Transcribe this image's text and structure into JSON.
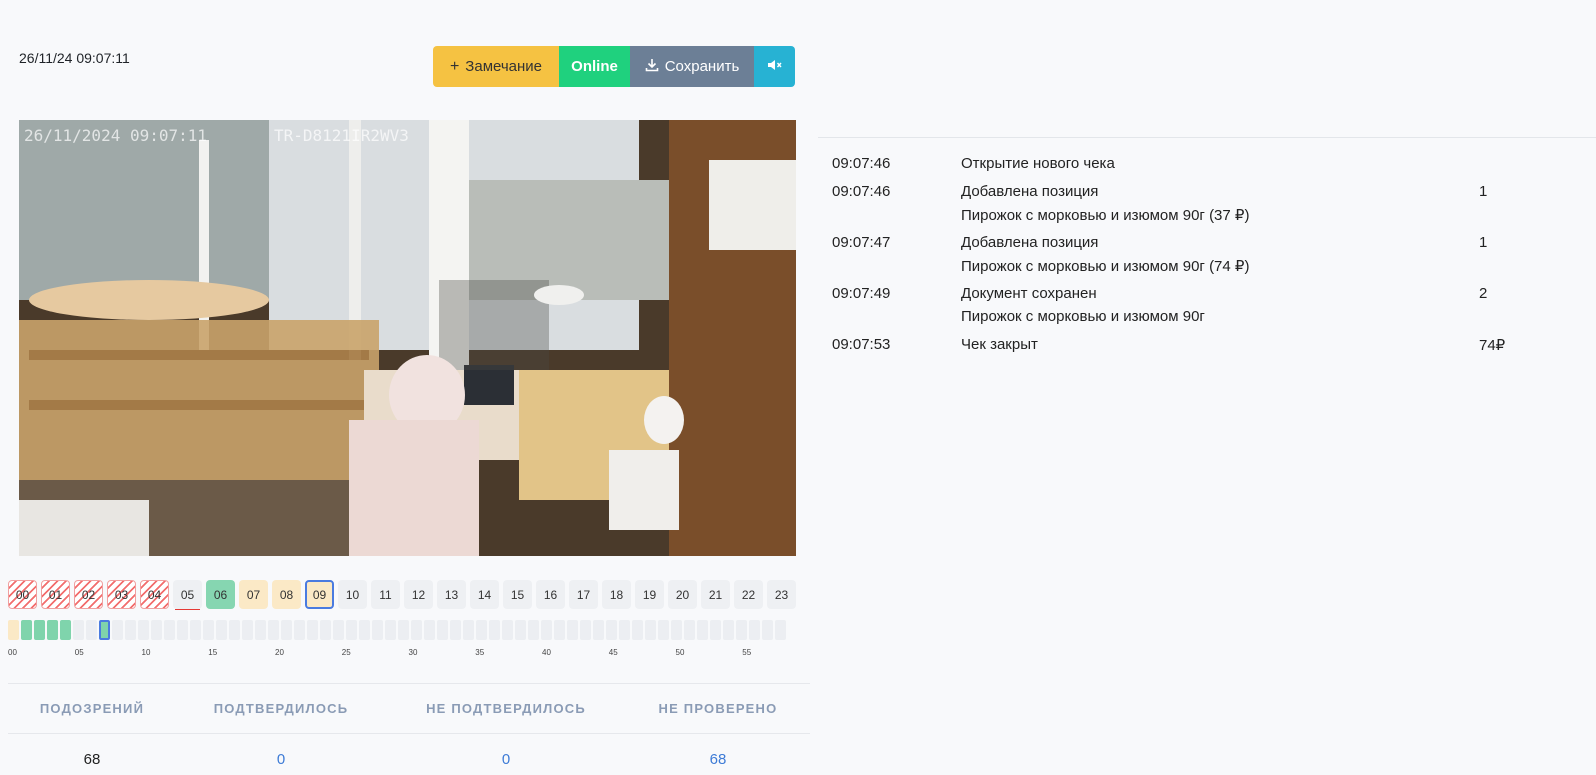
{
  "header": {
    "timestamp": "26/11/24 09:07:11"
  },
  "toolbar": {
    "remark_label": "Замечание",
    "online_label": "Online",
    "save_label": "Сохранить",
    "colors": {
      "remark": "#f5c242",
      "online": "#1fd17e",
      "save": "#6c7f96",
      "mute": "#27b2d3"
    }
  },
  "video": {
    "overlay_datetime": "26/11/2024 09:07:11",
    "overlay_camera": "TR-D8121IR2WV3"
  },
  "hours": [
    "00",
    "01",
    "02",
    "03",
    "04",
    "05",
    "06",
    "07",
    "08",
    "09",
    "10",
    "11",
    "12",
    "13",
    "14",
    "15",
    "16",
    "17",
    "18",
    "19",
    "20",
    "21",
    "22",
    "23"
  ],
  "minute_ticks": [
    "00",
    "05",
    "10",
    "15",
    "20",
    "25",
    "30",
    "35",
    "40",
    "45",
    "50",
    "55"
  ],
  "stats": {
    "headers": [
      "ПОДОЗРЕНИЙ",
      "ПОДТВЕРДИЛОСЬ",
      "НЕ ПОДТВЕРДИЛОСЬ",
      "НЕ ПРОВЕРЕНО"
    ],
    "values": [
      "68",
      "0",
      "0",
      "68"
    ]
  },
  "events": [
    {
      "time": "09:07:46",
      "title": "Открытие нового чека",
      "detail": "",
      "qty": ""
    },
    {
      "time": "09:07:46",
      "title": "Добавлена позиция",
      "detail": "Пирожок с морковью и изюмом 90г (37 ₽)",
      "qty": "1"
    },
    {
      "time": "09:07:47",
      "title": "Добавлена позиция",
      "detail": "Пирожок с морковью и изюмом 90г (74 ₽)",
      "qty": "1"
    },
    {
      "time": "09:07:49",
      "title": "Документ сохранен",
      "detail": "Пирожок с морковью и изюмом 90г",
      "qty": "2"
    },
    {
      "time": "09:07:53",
      "title": "Чек закрыт",
      "detail": "",
      "qty": "74₽"
    }
  ]
}
